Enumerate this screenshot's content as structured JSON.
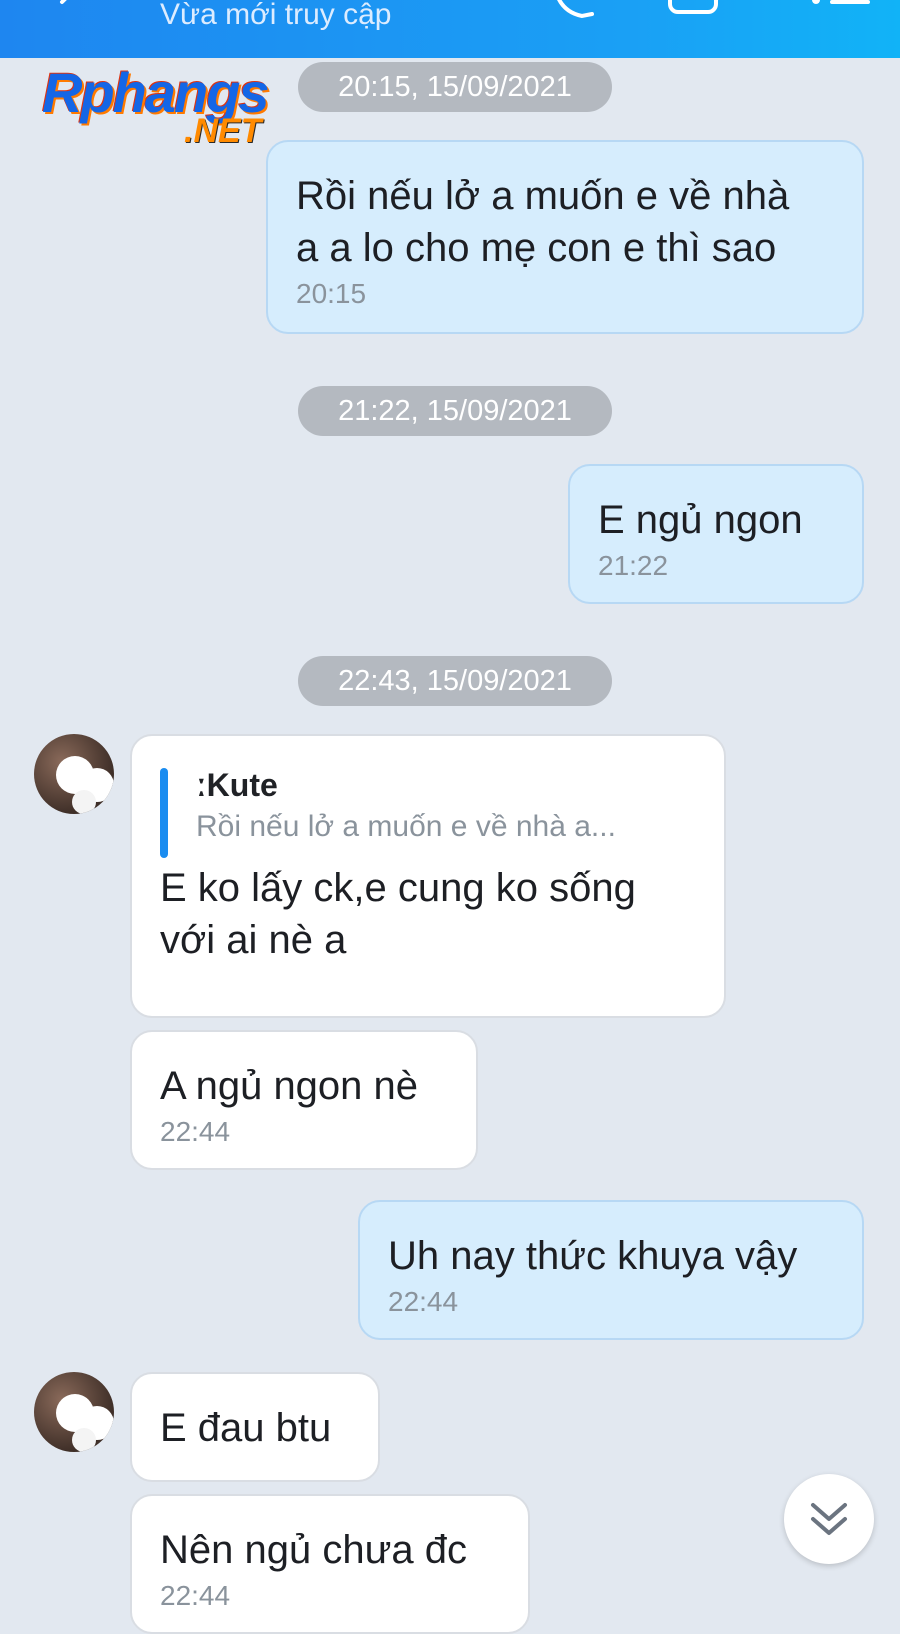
{
  "header": {
    "status": "Vừa mới truy cập",
    "icons": [
      "back-icon",
      "phone-icon",
      "video-icon",
      "menu-icon"
    ]
  },
  "watermark": {
    "main": "Rphangs",
    "sub": ".NET"
  },
  "messages": {
    "sep1": "20:15, 15/09/2021",
    "m1": {
      "line1": "Rồi nếu lở a muốn e về nhà",
      "line2": "a a lo cho mẹ con e thì sao",
      "time": "20:15"
    },
    "sep2": "21:22, 15/09/2021",
    "m2": {
      "text": "E ngủ ngon",
      "time": "21:22"
    },
    "sep3": "22:43, 15/09/2021",
    "m3": {
      "quote_name": "ːKute",
      "quote_text": "Rồi nếu lở a muốn e về nhà a...",
      "line1": "E ko lấy ck,e cung ko sống",
      "line2": "với ai nè a"
    },
    "m4": {
      "text": "A ngủ ngon nè",
      "time": "22:44"
    },
    "m5": {
      "text": "Uh nay thức khuya vậy",
      "time": "22:44"
    },
    "m6": {
      "text": "E đau btu"
    },
    "m7": {
      "text": "Nên ngủ chưa đc",
      "time": "22:44"
    }
  },
  "colors": {
    "header": "#1e86f0",
    "sent_bubble": "#d6edfd",
    "received_bubble": "#ffffff",
    "background": "#e2e8f0",
    "quote_bar": "#1a8cf0"
  }
}
